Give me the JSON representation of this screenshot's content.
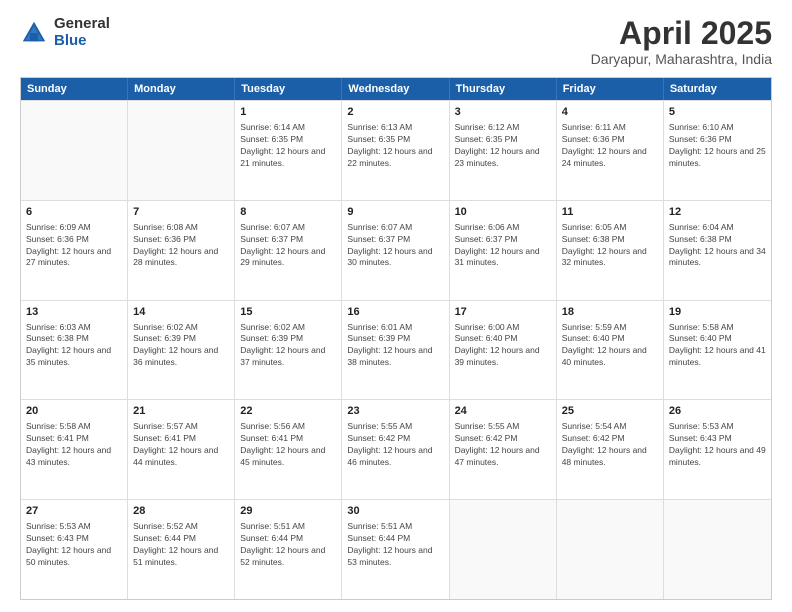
{
  "logo": {
    "general": "General",
    "blue": "Blue"
  },
  "header": {
    "month": "April 2025",
    "location": "Daryapur, Maharashtra, India"
  },
  "weekdays": [
    "Sunday",
    "Monday",
    "Tuesday",
    "Wednesday",
    "Thursday",
    "Friday",
    "Saturday"
  ],
  "rows": [
    [
      {
        "day": "",
        "sunrise": "",
        "sunset": "",
        "daylight": ""
      },
      {
        "day": "",
        "sunrise": "",
        "sunset": "",
        "daylight": ""
      },
      {
        "day": "1",
        "sunrise": "Sunrise: 6:14 AM",
        "sunset": "Sunset: 6:35 PM",
        "daylight": "Daylight: 12 hours and 21 minutes."
      },
      {
        "day": "2",
        "sunrise": "Sunrise: 6:13 AM",
        "sunset": "Sunset: 6:35 PM",
        "daylight": "Daylight: 12 hours and 22 minutes."
      },
      {
        "day": "3",
        "sunrise": "Sunrise: 6:12 AM",
        "sunset": "Sunset: 6:35 PM",
        "daylight": "Daylight: 12 hours and 23 minutes."
      },
      {
        "day": "4",
        "sunrise": "Sunrise: 6:11 AM",
        "sunset": "Sunset: 6:36 PM",
        "daylight": "Daylight: 12 hours and 24 minutes."
      },
      {
        "day": "5",
        "sunrise": "Sunrise: 6:10 AM",
        "sunset": "Sunset: 6:36 PM",
        "daylight": "Daylight: 12 hours and 25 minutes."
      }
    ],
    [
      {
        "day": "6",
        "sunrise": "Sunrise: 6:09 AM",
        "sunset": "Sunset: 6:36 PM",
        "daylight": "Daylight: 12 hours and 27 minutes."
      },
      {
        "day": "7",
        "sunrise": "Sunrise: 6:08 AM",
        "sunset": "Sunset: 6:36 PM",
        "daylight": "Daylight: 12 hours and 28 minutes."
      },
      {
        "day": "8",
        "sunrise": "Sunrise: 6:07 AM",
        "sunset": "Sunset: 6:37 PM",
        "daylight": "Daylight: 12 hours and 29 minutes."
      },
      {
        "day": "9",
        "sunrise": "Sunrise: 6:07 AM",
        "sunset": "Sunset: 6:37 PM",
        "daylight": "Daylight: 12 hours and 30 minutes."
      },
      {
        "day": "10",
        "sunrise": "Sunrise: 6:06 AM",
        "sunset": "Sunset: 6:37 PM",
        "daylight": "Daylight: 12 hours and 31 minutes."
      },
      {
        "day": "11",
        "sunrise": "Sunrise: 6:05 AM",
        "sunset": "Sunset: 6:38 PM",
        "daylight": "Daylight: 12 hours and 32 minutes."
      },
      {
        "day": "12",
        "sunrise": "Sunrise: 6:04 AM",
        "sunset": "Sunset: 6:38 PM",
        "daylight": "Daylight: 12 hours and 34 minutes."
      }
    ],
    [
      {
        "day": "13",
        "sunrise": "Sunrise: 6:03 AM",
        "sunset": "Sunset: 6:38 PM",
        "daylight": "Daylight: 12 hours and 35 minutes."
      },
      {
        "day": "14",
        "sunrise": "Sunrise: 6:02 AM",
        "sunset": "Sunset: 6:39 PM",
        "daylight": "Daylight: 12 hours and 36 minutes."
      },
      {
        "day": "15",
        "sunrise": "Sunrise: 6:02 AM",
        "sunset": "Sunset: 6:39 PM",
        "daylight": "Daylight: 12 hours and 37 minutes."
      },
      {
        "day": "16",
        "sunrise": "Sunrise: 6:01 AM",
        "sunset": "Sunset: 6:39 PM",
        "daylight": "Daylight: 12 hours and 38 minutes."
      },
      {
        "day": "17",
        "sunrise": "Sunrise: 6:00 AM",
        "sunset": "Sunset: 6:40 PM",
        "daylight": "Daylight: 12 hours and 39 minutes."
      },
      {
        "day": "18",
        "sunrise": "Sunrise: 5:59 AM",
        "sunset": "Sunset: 6:40 PM",
        "daylight": "Daylight: 12 hours and 40 minutes."
      },
      {
        "day": "19",
        "sunrise": "Sunrise: 5:58 AM",
        "sunset": "Sunset: 6:40 PM",
        "daylight": "Daylight: 12 hours and 41 minutes."
      }
    ],
    [
      {
        "day": "20",
        "sunrise": "Sunrise: 5:58 AM",
        "sunset": "Sunset: 6:41 PM",
        "daylight": "Daylight: 12 hours and 43 minutes."
      },
      {
        "day": "21",
        "sunrise": "Sunrise: 5:57 AM",
        "sunset": "Sunset: 6:41 PM",
        "daylight": "Daylight: 12 hours and 44 minutes."
      },
      {
        "day": "22",
        "sunrise": "Sunrise: 5:56 AM",
        "sunset": "Sunset: 6:41 PM",
        "daylight": "Daylight: 12 hours and 45 minutes."
      },
      {
        "day": "23",
        "sunrise": "Sunrise: 5:55 AM",
        "sunset": "Sunset: 6:42 PM",
        "daylight": "Daylight: 12 hours and 46 minutes."
      },
      {
        "day": "24",
        "sunrise": "Sunrise: 5:55 AM",
        "sunset": "Sunset: 6:42 PM",
        "daylight": "Daylight: 12 hours and 47 minutes."
      },
      {
        "day": "25",
        "sunrise": "Sunrise: 5:54 AM",
        "sunset": "Sunset: 6:42 PM",
        "daylight": "Daylight: 12 hours and 48 minutes."
      },
      {
        "day": "26",
        "sunrise": "Sunrise: 5:53 AM",
        "sunset": "Sunset: 6:43 PM",
        "daylight": "Daylight: 12 hours and 49 minutes."
      }
    ],
    [
      {
        "day": "27",
        "sunrise": "Sunrise: 5:53 AM",
        "sunset": "Sunset: 6:43 PM",
        "daylight": "Daylight: 12 hours and 50 minutes."
      },
      {
        "day": "28",
        "sunrise": "Sunrise: 5:52 AM",
        "sunset": "Sunset: 6:44 PM",
        "daylight": "Daylight: 12 hours and 51 minutes."
      },
      {
        "day": "29",
        "sunrise": "Sunrise: 5:51 AM",
        "sunset": "Sunset: 6:44 PM",
        "daylight": "Daylight: 12 hours and 52 minutes."
      },
      {
        "day": "30",
        "sunrise": "Sunrise: 5:51 AM",
        "sunset": "Sunset: 6:44 PM",
        "daylight": "Daylight: 12 hours and 53 minutes."
      },
      {
        "day": "",
        "sunrise": "",
        "sunset": "",
        "daylight": ""
      },
      {
        "day": "",
        "sunrise": "",
        "sunset": "",
        "daylight": ""
      },
      {
        "day": "",
        "sunrise": "",
        "sunset": "",
        "daylight": ""
      }
    ]
  ]
}
